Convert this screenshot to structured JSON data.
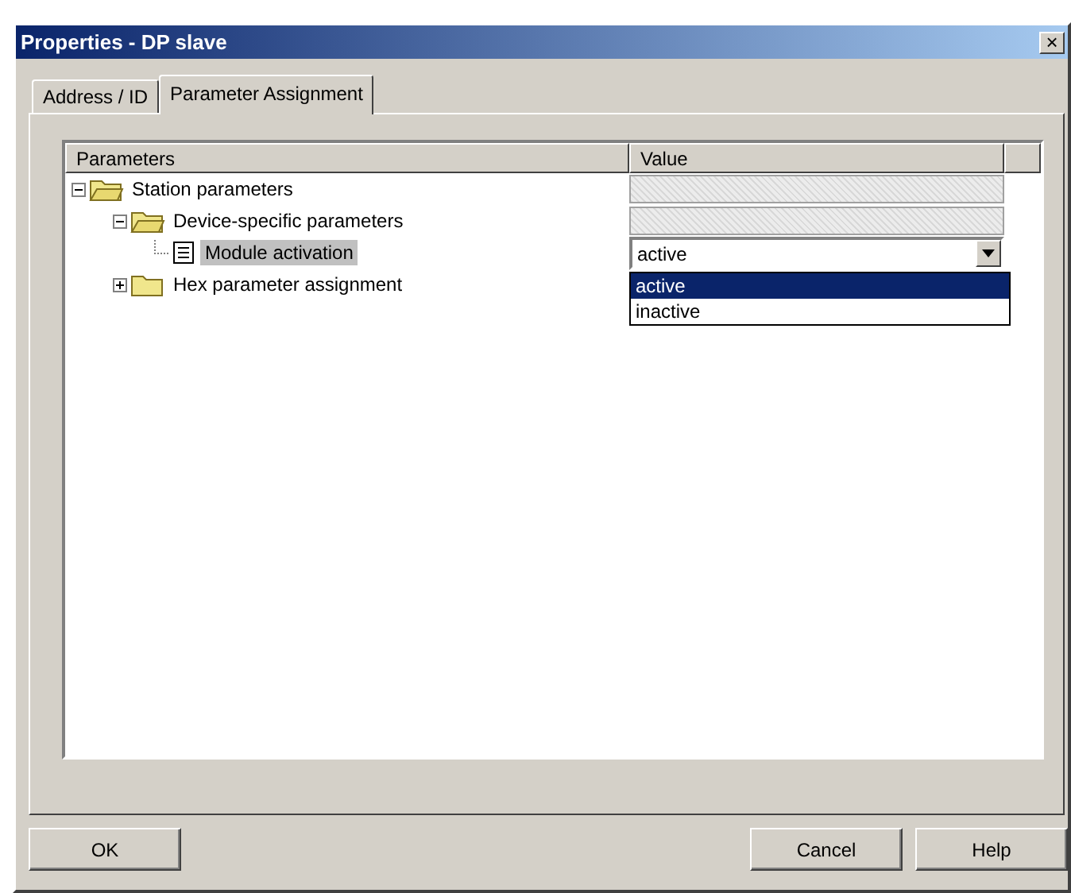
{
  "window": {
    "title": "Properties - DP slave",
    "close": "×"
  },
  "tabs": [
    {
      "label": "Address / ID",
      "selected": false
    },
    {
      "label": "Parameter Assignment",
      "selected": true
    }
  ],
  "table": {
    "columns": [
      "Parameters",
      "Value"
    ],
    "tree": [
      {
        "label": "Station parameters",
        "expanded": true,
        "selected": false,
        "value": {
          "kind": "greyed"
        },
        "children": [
          {
            "label": "Device-specific parameters",
            "expanded": true,
            "selected": false,
            "value": {
              "kind": "greyed"
            },
            "children": [
              {
                "label": "Module activation",
                "selected": true,
                "value": {
                  "kind": "combo",
                  "text": "active",
                  "open": true,
                  "options": [
                    {
                      "label": "active",
                      "selected": true
                    },
                    {
                      "label": "inactive",
                      "selected": false
                    }
                  ]
                }
              }
            ]
          },
          {
            "label": "Hex parameter assignment",
            "expanded": false,
            "selected": false
          }
        ]
      }
    ]
  },
  "buttons": [
    "OK",
    "Cancel",
    "Help"
  ]
}
